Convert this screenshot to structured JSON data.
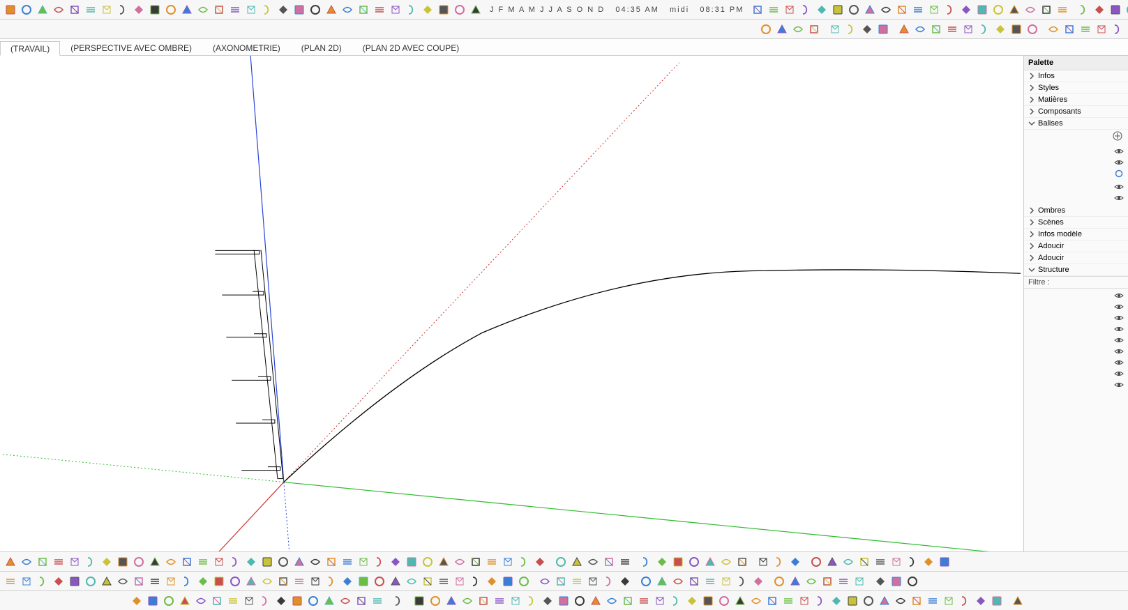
{
  "header": {
    "calendar_letters": "J F M A M J J A S O N D",
    "time1": "04:35 AM",
    "midi": "midi",
    "time2": "08:31 PM"
  },
  "tabs": [
    {
      "label": "(TRAVAIL)",
      "active": true
    },
    {
      "label": "(PERSPECTIVE AVEC OMBRE)",
      "active": false
    },
    {
      "label": "(AXONOMETRIE)",
      "active": false
    },
    {
      "label": "(PLAN 2D)",
      "active": false
    },
    {
      "label": "(PLAN 2D AVEC COUPE)",
      "active": false
    }
  ],
  "palette": {
    "title": "Palette",
    "sections": [
      {
        "label": "Infos",
        "open": false
      },
      {
        "label": "Styles",
        "open": false
      },
      {
        "label": "Matières",
        "open": false
      },
      {
        "label": "Composants",
        "open": false
      },
      {
        "label": "Balises",
        "open": true
      }
    ],
    "add_icon": "+",
    "layer_states": [
      "eye",
      "eye",
      "circle-selected",
      "eye",
      "eye"
    ],
    "sections2": [
      {
        "label": "Ombres",
        "open": false
      },
      {
        "label": "Scènes",
        "open": false
      },
      {
        "label": "Infos modèle",
        "open": false
      },
      {
        "label": "Adoucir",
        "open": false
      },
      {
        "label": "Adoucir",
        "open": false
      },
      {
        "label": "Structure",
        "open": true
      }
    ],
    "filter_label": "Filtre :",
    "structure_rows": 9
  },
  "toolbar_top_icons": [
    "select-tool",
    "component-tool",
    "group-tool",
    "push-pull-tool",
    "move-tool",
    "rotate-tool",
    "scale-tool",
    "scissors-icon",
    "tape-tool",
    "paint-bucket-tool",
    "eraser-tool",
    "line-tool",
    "rectangle-tool",
    "circle-tool",
    "arc-tool",
    "polygon-tool",
    "follow-me-tool",
    "offset-tool",
    "undo-icon",
    "redo-icon",
    "section-plane-tool",
    "text-tool",
    "dimension-tool",
    "axes-tool",
    "walk-tool",
    "protractor-tool",
    "freehand-tool",
    "curve-tool",
    "3d-text-tool",
    "pan-tool",
    "orbit-tool",
    "zoom-tool",
    "zoom-extents-icon",
    "zoom-window-icon",
    "prev-view-icon",
    "next-view-icon",
    "position-camera-tool",
    "look-around-tool",
    "walk-through-tool",
    "grid-1-icon",
    "grid-2-icon",
    "grid-3-icon",
    "grid-4-icon",
    "grid-5-icon",
    "grid-6-icon",
    "grid-7-icon",
    "grid-8-icon",
    "grid-9-icon",
    "grid-10-icon",
    "grid-11-icon",
    "separator",
    "curve-1-icon",
    "curve-2-icon",
    "curve-3-icon",
    "curve-4-icon",
    "curve-5-icon",
    "curve-6-icon",
    "curve-7-icon",
    "curve-8-icon",
    "curve-9-icon",
    "rect-round-icon",
    "ellipse-icon",
    "arc-ccw-icon",
    "arc-cw-icon",
    "circle-thin-icon",
    "circle-thick-icon",
    "bolt-icon",
    "wrench-icon"
  ],
  "toolbar_top2_icons": [
    "view-front-icon",
    "view-back-icon",
    "view-top-icon",
    "view-iso-icon",
    "separator",
    "flag-red-icon",
    "flag-green-icon",
    "flag-blue-icon",
    "mirror-icon",
    "separator",
    "shape-diamond-green-icon",
    "shape-octagon-green-icon",
    "shape-cube-green-icon",
    "shape-cube2-green-icon",
    "shape-diamond-red-icon",
    "shape-octagon-red-icon",
    "shape-cube-red-icon",
    "shape-cube2-red-icon",
    "texture-panel-icon",
    "separator",
    "tool-a-icon",
    "tool-b-icon",
    "tool-c-icon",
    "tool-d-icon",
    "tool-e-icon"
  ],
  "bottombar1_icons": [
    "door-1-icon",
    "door-2-icon",
    "door-3-icon",
    "door-4-icon",
    "door-5-icon",
    "door-6-icon",
    "door-7-icon",
    "door-8-icon",
    "door-9-icon",
    "door-10-icon",
    "door-11-icon",
    "door-12-icon",
    "door-13-icon",
    "door-14-icon",
    "roof-1-icon",
    "roof-2-icon",
    "roof-3-icon",
    "roof-4-icon",
    "roof-5-icon",
    "roof-6-icon",
    "section-cut-icon",
    "calendar-icon",
    "layer-1-icon",
    "layer-2-icon",
    "arrow-left-icon",
    "arrow-right-icon",
    "arrow-up-icon",
    "arrow-both-icon",
    "num-1-icon",
    "num-11-icon",
    "bolt-sm-icon",
    "bolt-crossed-icon",
    "magnifier-icon",
    "gear-icon",
    "separator",
    "camera-icon",
    "target-icon",
    "sun-up-icon",
    "film-icon",
    "copy-icon",
    "separator",
    "person-icon",
    "fx-a-icon",
    "fx-f-icon",
    "info-icon",
    "clapper-icon",
    "clapper-play-icon",
    "refresh-icon",
    "separator",
    "cube-blue-icon",
    "cube-orange-icon",
    "stack-icon",
    "separator",
    "box-1-icon",
    "box-2-icon",
    "box-3-icon",
    "box-4-icon",
    "box-5-icon",
    "box-clock-icon",
    "box-green-icon",
    "ral-badge-icon",
    "sphere-icon"
  ],
  "bottombar2_icons": [
    "win-1-icon",
    "win-2-icon",
    "win-3-icon",
    "win-4-icon",
    "win-5-icon",
    "win-grid-icon",
    "win-cut-icon",
    "win-paste-icon",
    "win-copy-icon",
    "win-tab-icon",
    "wall-1-icon",
    "wall-2-icon",
    "wall-3-icon",
    "wall-4-icon",
    "wall-5-icon",
    "wall-6-icon",
    "wall-7-icon",
    "wall-8-icon",
    "wall-9-icon",
    "wall-10-icon",
    "wall-11-icon",
    "wall-12-icon",
    "wall-13-icon",
    "wall-14-icon",
    "cabinet-1-icon",
    "cabinet-2-icon",
    "cabinet-3-icon",
    "cabinet-4-icon",
    "cabinet-5-icon",
    "cabinet-6-icon",
    "cabinet-7-icon",
    "cabinet-8-icon",
    "cabinet-9-icon",
    "separator",
    "arrow-nw-icon",
    "pointer-icon",
    "move-xy-icon",
    "rotate-ccw-icon",
    "scale-box-icon",
    "help-icon",
    "separator",
    "node-1-icon",
    "node-2-icon",
    "node-3-icon",
    "node-4-icon",
    "node-5-icon",
    "node-6-icon",
    "node-7-icon",
    "node-8-icon",
    "separator",
    "frame-1-icon",
    "frame-2-icon",
    "frame-3-icon",
    "frame-4-icon",
    "frame-5-icon",
    "frame-6-icon",
    "separator",
    "pad-1-icon",
    "pad-2-icon",
    "pad-3-icon"
  ],
  "bottombar3_icons": [
    "cube-lg-1-icon",
    "cube-lg-2-icon",
    "cube-sm-icon",
    "cube-del-icon",
    "mat-1-icon",
    "mat-2-icon",
    "mat-3-icon",
    "mat-4-icon",
    "mat-5-icon",
    "mat-6-icon",
    "mat-7-icon",
    "mat-8-icon",
    "mat-9-icon",
    "mat-10-icon",
    "sphere-wire-icon",
    "sphere-solid-icon",
    "separator",
    "puzzle-icon",
    "separator",
    "tiny-cursor-icon",
    "grid-a-icon",
    "grid-b-icon",
    "align-left-icon",
    "align-center-icon",
    "align-right-icon",
    "align-top-icon",
    "align-mid-icon",
    "align-bot-icon",
    "dist-h-icon",
    "dist-v-icon",
    "tile-1-icon",
    "tile-2-icon",
    "tile-3-icon",
    "tile-4-icon",
    "tile-5-icon",
    "tile-6-icon",
    "tile-7-icon",
    "tile-8-icon",
    "tile-9-icon",
    "tile-10-icon",
    "tile-11-icon",
    "tile-12-icon",
    "tile-13-icon",
    "tile-14-icon",
    "tile-15-icon",
    "tile-16-icon",
    "dot-grid-1-icon",
    "dot-grid-2-icon",
    "dot-grid-3-icon",
    "dot-grid-4-icon",
    "dot-grid-5-icon",
    "dot-grid-6-icon",
    "dot-grid-7-icon",
    "dot-grid-8-icon",
    "dot-grid-9-icon",
    "dot-grid-10-icon",
    "separator",
    "reorder-list-icon"
  ]
}
